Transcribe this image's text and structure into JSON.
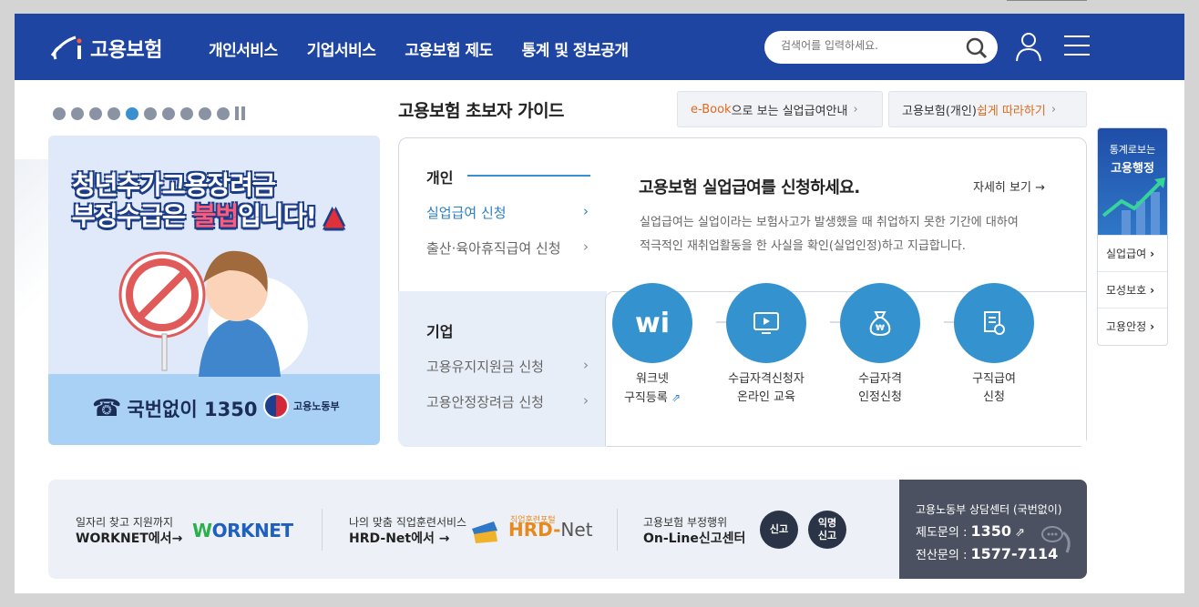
{
  "header": {
    "logo_text": "고용보험",
    "nav": [
      "개인서비스",
      "기업서비스",
      "고용보험 제도",
      "통계 및 정보공개"
    ],
    "search_placeholder": "검색어를 입력하세요."
  },
  "slider": {
    "dot_count": 10,
    "active_index": 4
  },
  "banner": {
    "line1": "청년추가고용장려금",
    "line2_prefix": "부정수급은 ",
    "line2_red": "불법",
    "line2_suffix": "입니다!",
    "phone": "국번없이 1350",
    "ministry": "고용노동부"
  },
  "guide": {
    "title": "고용보험 초보자 가이드",
    "ebook_hl": "e-Book",
    "ebook_rest": "으로 보는 실업급여안내",
    "easy_prefix": "고용보험(개인) ",
    "easy_hl": "쉽게 따라하기"
  },
  "personal": {
    "label": "개인",
    "items": [
      "실업급여 신청",
      "출산·육아휴직급여 신청"
    ]
  },
  "biz": {
    "label": "기업",
    "items": [
      "고용유지지원금 신청",
      "고용안정장려금 신청"
    ]
  },
  "apply": {
    "title": "고용보험 실업급여를 신청하세요.",
    "more": "자세히 보기",
    "desc1": "실업급여는 실업이라는 보험사고가 발생했을 때 취업하지 못한 기간에 대하여",
    "desc2": "적극적인 재취업활동을 한 사실을 확인(실업인정)하고 지급합니다.",
    "steps": [
      {
        "l1": "워크넷",
        "l2": "구직등록"
      },
      {
        "l1": "수급자격신청자",
        "l2": "온라인 교육"
      },
      {
        "l1": "수급자격",
        "l2": "인정신청"
      },
      {
        "l1": "구직급여",
        "l2": "신청"
      }
    ]
  },
  "quick": {
    "t1": "통계로보는",
    "t2": "고용행정",
    "items": [
      "실업급여",
      "모성보호",
      "고용안정"
    ]
  },
  "footer": {
    "worknet_l1": "일자리 찾고 지원까지",
    "worknet_l2": "WORKNET에서→",
    "worknet_logo_w": "W",
    "worknet_logo": "ORKNET",
    "hrd_l1": "나의 맞춤 직업훈련서비스",
    "hrd_l2": "HRD-Net에서 →",
    "hrd_small": "직업훈련포털",
    "hrd_logo": "HRD-",
    "hrd_logo_net": "Net",
    "fraud_l1": "고용보험 부정행위",
    "fraud_l2": "On-Line신고센터",
    "btn_report": "신고",
    "btn_anon_1": "익명",
    "btn_anon_2": "신고",
    "cc_title": "고용노동부 상담센터 (국번없이)",
    "cc_l1_label": "제도문의 : ",
    "cc_l1_num": "1350",
    "cc_l2_label": "전산문의 : ",
    "cc_l2_num": "1577-7114"
  },
  "colors": {
    "header_bg": "#1f45a3",
    "accent": "#3493cf",
    "orange": "#e06a1e"
  }
}
